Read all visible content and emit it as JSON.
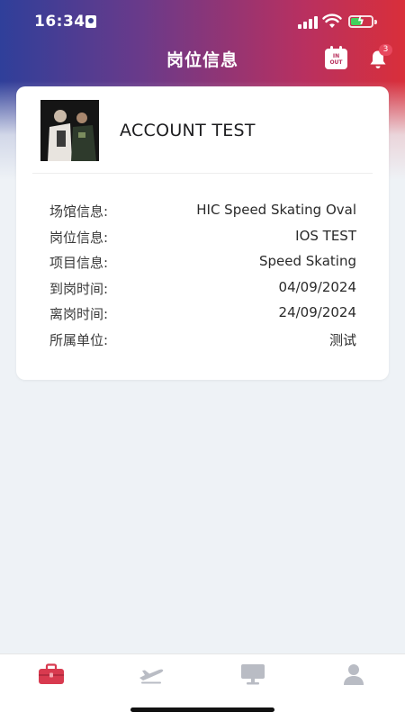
{
  "status_bar": {
    "time": "16:34",
    "battery_level": 0.55
  },
  "header": {
    "title": "岗位信息",
    "calendar_icon_line1": "IN",
    "calendar_icon_line2": "OUT",
    "notification_count": "3"
  },
  "profile": {
    "name": "ACCOUNT TEST"
  },
  "info": {
    "rows": [
      {
        "label": "场馆信息:",
        "value": "HIC Speed Skating Oval"
      },
      {
        "label": "岗位信息:",
        "value": "IOS TEST"
      },
      {
        "label": "项目信息:",
        "value": "Speed Skating"
      },
      {
        "label": "到岗时间:",
        "value": "04/09/2024"
      },
      {
        "label": "离岗时间:",
        "value": "24/09/2024"
      },
      {
        "label": "所属单位:",
        "value": "测试"
      }
    ]
  },
  "tabs": [
    {
      "icon": "briefcase-icon",
      "active": true
    },
    {
      "icon": "airplane-icon",
      "active": false
    },
    {
      "icon": "monitor-icon",
      "active": false
    },
    {
      "icon": "user-icon",
      "active": false
    }
  ],
  "colors": {
    "gradient_left": "#2f3f9a",
    "gradient_right": "#d92f3a",
    "accent_active_tab": "#d83a4f",
    "inactive_tab": "#b9bcc4",
    "badge": "#e8485e"
  }
}
